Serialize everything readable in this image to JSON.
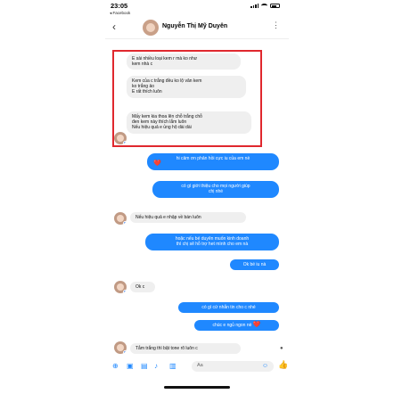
{
  "status_bar": {
    "time": "23:05",
    "back_app": "◂ Facebook"
  },
  "header": {
    "contact_name": "Nguyễn Thị Mỹ Duyên"
  },
  "quoted_messages": [
    "E sài nhiều loại kem r mà ko như\nkem nhà c",
    "Kem của c trắng đều ko lộ vân kem\nko trắng ảo\nE rất thích luôn",
    "Mấy kem kia thoa lên chỗ trắng chỗ\nđen kem này thích lắm luôn\nNếu hiệu quả e ủng hộ dài dài"
  ],
  "messages": [
    {
      "dir": "out",
      "text": "hi cảm ơn phản hồi cực iu của em nè",
      "heart": "❤️"
    },
    {
      "dir": "out",
      "text": "có gì giới thiệu cho mọi người giúp\nchị nhé"
    },
    {
      "dir": "in",
      "text": "Nếu hiệu quả e nhập về bán luôn"
    },
    {
      "dir": "out",
      "text": "hoặc nếu bé duyên muốn kinh doanh\nthì chị sẽ hỗ trợ het mình cho em nà"
    },
    {
      "dir": "out",
      "text": "Ok bé iu nà"
    },
    {
      "dir": "in",
      "text": "Ok c"
    },
    {
      "dir": "out",
      "text": "có gì cứ nhắn tin cho c nhé"
    },
    {
      "dir": "out",
      "text": "chúc e ngủ ngon nè",
      "heart": "❤️"
    },
    {
      "dir": "in",
      "text": "Tắm trắng thì bật tone rõ luôn c"
    }
  ],
  "composer": {
    "placeholder": "Aa"
  },
  "colors": {
    "accent": "#1f88ff",
    "highlight_border": "#e0282e",
    "incoming_bubble": "#efefef"
  }
}
